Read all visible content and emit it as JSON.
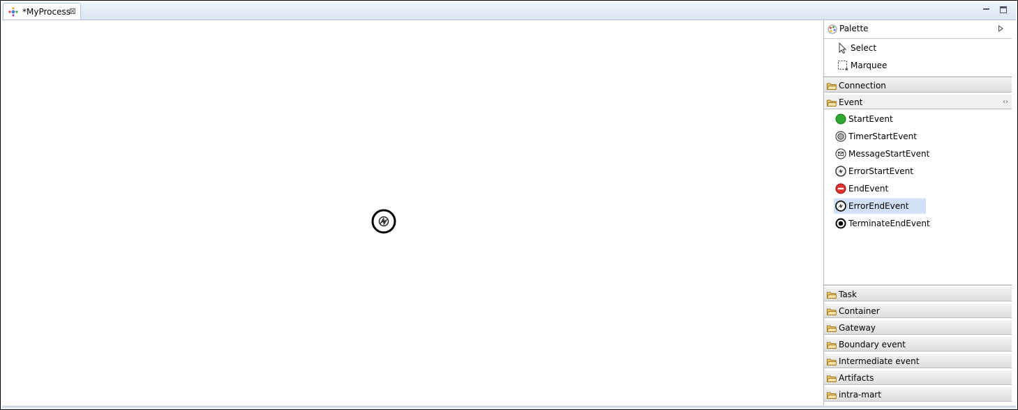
{
  "editor": {
    "tab_title": "*MyProcess",
    "close_glyph": "⊠"
  },
  "window": {
    "minimize": "minimize",
    "maximize": "maximize"
  },
  "palette": {
    "title": "Palette",
    "tools": [
      {
        "label": "Select",
        "icon": "select-arrow-icon"
      },
      {
        "label": "Marquee",
        "icon": "marquee-icon"
      }
    ],
    "drawers": {
      "connection": "Connection",
      "event": "Event",
      "task": "Task",
      "container": "Container",
      "gateway": "Gateway",
      "boundary": "Boundary event",
      "intermediate": "Intermediate event",
      "artifacts": "Artifacts",
      "intramart": "intra-mart"
    },
    "event_items": [
      {
        "label": "StartEvent",
        "icon": "start-event-icon"
      },
      {
        "label": "TimerStartEvent",
        "icon": "timer-start-event-icon"
      },
      {
        "label": "MessageStartEvent",
        "icon": "message-start-event-icon"
      },
      {
        "label": "ErrorStartEvent",
        "icon": "error-start-event-icon"
      },
      {
        "label": "EndEvent",
        "icon": "end-event-icon"
      },
      {
        "label": "ErrorEndEvent",
        "icon": "error-end-event-icon",
        "selected": true
      },
      {
        "label": "TerminateEndEvent",
        "icon": "terminate-end-event-icon"
      }
    ]
  },
  "canvas": {
    "elements": [
      {
        "type": "ErrorEndEvent",
        "icon": "error-end-event-icon"
      }
    ]
  },
  "colors": {
    "tabbar": "#dbe6f5",
    "selection": "#cfe0f7",
    "start_event": "#2fa82f",
    "end_event": "#e03030",
    "folder": "#f4c86a"
  }
}
